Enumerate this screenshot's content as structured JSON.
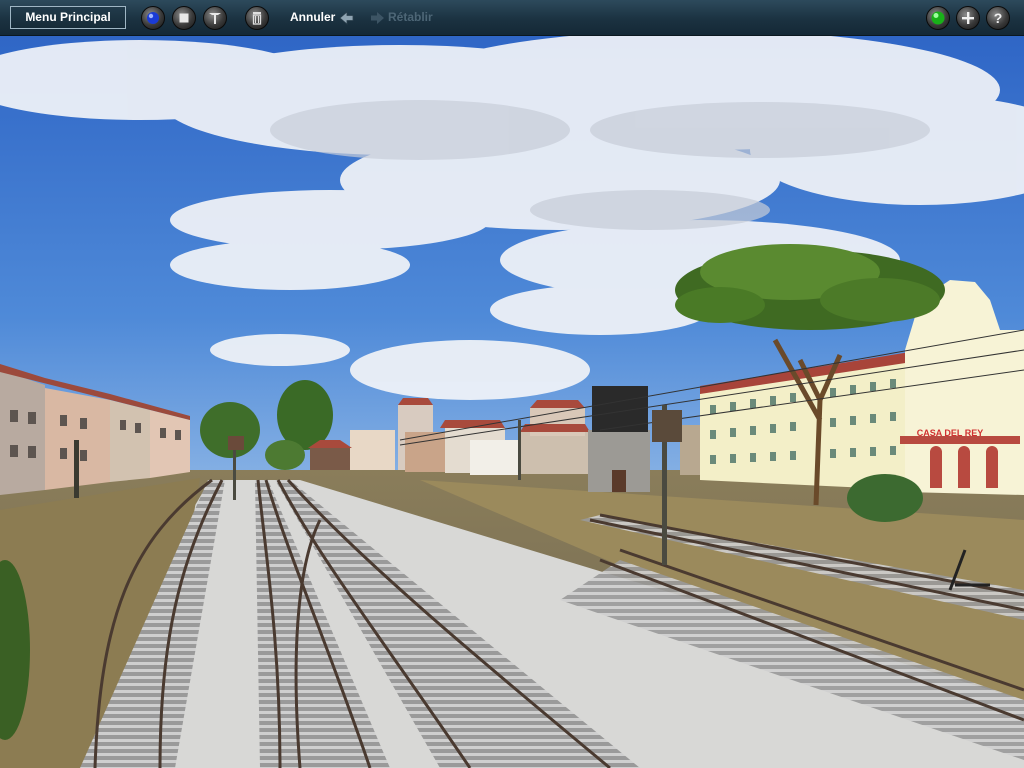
{
  "toolbar": {
    "menu_label": "Menu Principal",
    "undo_label": "Annuler",
    "redo_label": "Rétablir"
  },
  "icons": {
    "left": [
      "sphere-icon",
      "stop-icon",
      "tools-icon",
      "trash-icon"
    ],
    "undo": "undo-arrow-icon",
    "redo": "redo-arrow-icon",
    "right": [
      "green-status-icon",
      "plus-icon",
      "help-icon"
    ]
  },
  "scene": {
    "building_sign": "CASA DEL REY"
  },
  "colors": {
    "toolbar_bg": "#1b3241",
    "sky": "#3f7fd0",
    "status_green": "#2fd12f",
    "building": "#f3efc8",
    "roof": "#a8443a"
  }
}
